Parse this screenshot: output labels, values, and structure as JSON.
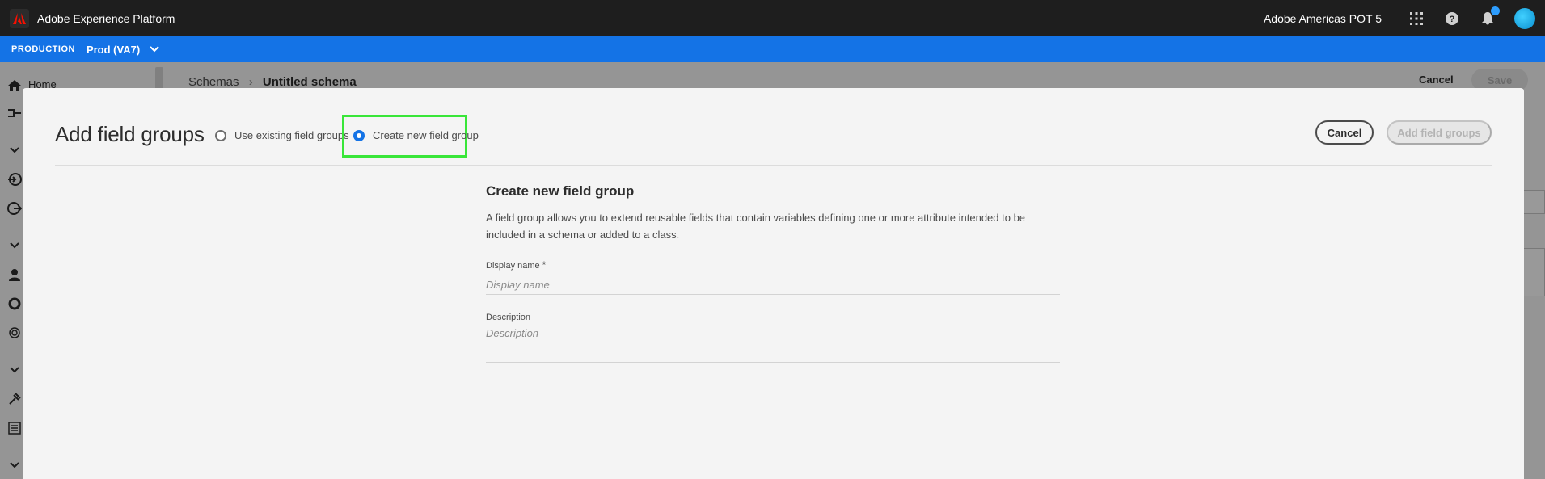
{
  "app": {
    "title": "Adobe Experience Platform",
    "org_name": "Adobe Americas POT 5"
  },
  "environment": {
    "label": "PRODUCTION",
    "sandbox": "Prod (VA7)"
  },
  "background": {
    "nav_home_label": "Home",
    "breadcrumb_parent": "Schemas",
    "breadcrumb_current": "Untitled schema",
    "cancel_label": "Cancel",
    "save_label": "Save"
  },
  "modal": {
    "title": "Add field groups",
    "option_existing": "Use existing field groups",
    "option_new": "Create new field group",
    "selected_option": "Create new field group",
    "cancel_label": "Cancel",
    "add_label": "Add field groups",
    "form": {
      "heading": "Create new field group",
      "description": "A field group allows you to extend reusable fields that contain variables defining one or more attribute intended to be included in a schema or added to a class.",
      "display_name_label": "Display name",
      "display_name_required": "*",
      "display_name_placeholder": "Display name",
      "display_name_value": "",
      "description_label": "Description",
      "description_placeholder": "Description",
      "description_value": ""
    }
  },
  "colors": {
    "topbar": "#1e1e1e",
    "envbar": "#1473e6",
    "accent": "#1473e6",
    "highlight": "#39e639"
  }
}
